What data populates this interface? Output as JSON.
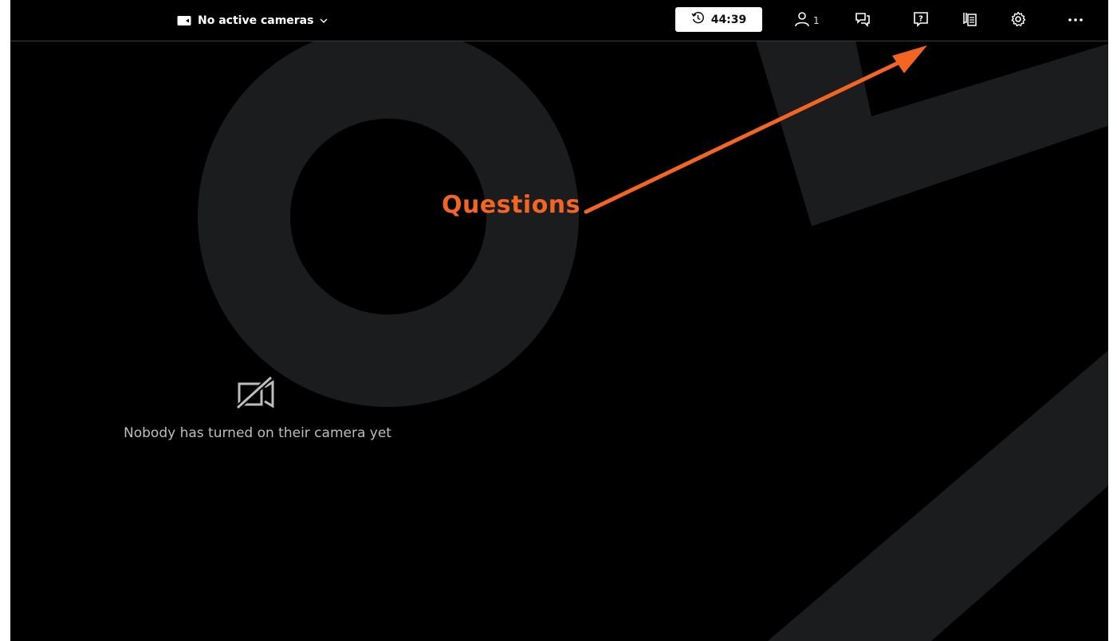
{
  "topbar": {
    "camera_selector": {
      "label": "No active cameras",
      "icon": "video-camera-icon",
      "chevron": "chevron-down-icon"
    },
    "timer": {
      "value": "44:39",
      "icon": "clock-history-icon"
    },
    "buttons": [
      {
        "name": "participants-button",
        "icon": "person-icon",
        "count": "1"
      },
      {
        "name": "chat-button",
        "icon": "chat-bubbles-icon"
      },
      {
        "name": "questions-button",
        "icon": "question-bubble-icon"
      },
      {
        "name": "notes-button",
        "icon": "notes-icon"
      },
      {
        "name": "settings-button",
        "icon": "gear-icon"
      },
      {
        "name": "more-button",
        "icon": "more-horizontal-icon"
      }
    ]
  },
  "main": {
    "empty_state": {
      "icon": "camera-off-icon",
      "message": "Nobody has turned on their camera yet"
    }
  },
  "annotation": {
    "label": "Questions",
    "color": "#f26522"
  },
  "colors": {
    "background": "#000000",
    "shape": "#1a1c1e",
    "accent": "#f26522"
  }
}
